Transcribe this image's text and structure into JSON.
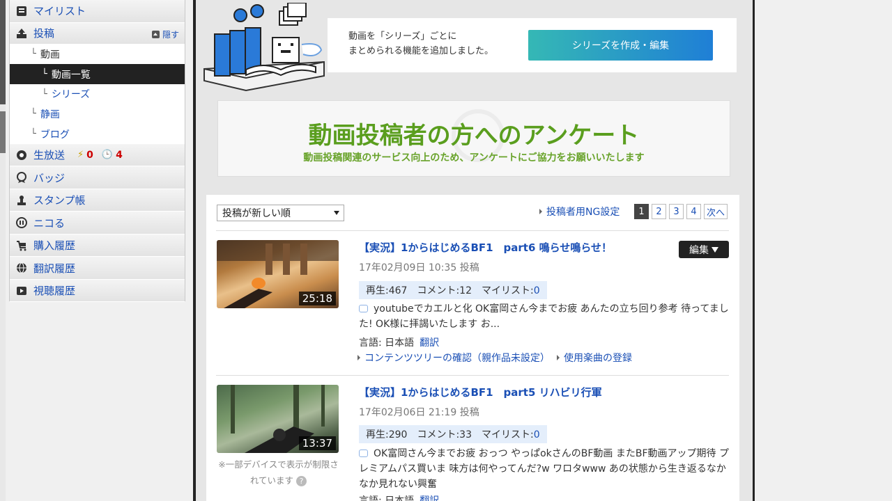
{
  "sidebar": {
    "mylist": "マイリスト",
    "posts": "投稿",
    "hide": "隠す",
    "video": "動画",
    "video_list": "動画一覧",
    "series": "シリーズ",
    "still": "静画",
    "blog": "ブログ",
    "live": "生放送",
    "live_count_a": "0",
    "live_count_b": "4",
    "badge": "バッジ",
    "stamp": "スタンプ帳",
    "nicoru": "ニコる",
    "purchase": "購入履歴",
    "translate": "翻訳履歴",
    "watch_history": "視聴履歴"
  },
  "banner": {
    "line1": "動画を「シリーズ」ごとに",
    "line2": "まとめられる機能を追加しました。",
    "button": "シリーズを作成・編集"
  },
  "survey": {
    "title": "動画投稿者の方へのアンケート",
    "subtitle": "動画投稿関連のサービス向上のため、アンケートにご協力をお願いいたします"
  },
  "toolbar": {
    "sort": "投稿が新しい順",
    "ng_link": "投稿者用NG設定",
    "pages": [
      "1",
      "2",
      "3",
      "4"
    ],
    "next": "次へ"
  },
  "videos": [
    {
      "title": "【実況】1からはじめるBF1　part6 鳴らせ鳴らせ！",
      "date": "17年02月09日 10:35 投稿",
      "duration": "25:18",
      "views": "再生:467",
      "comments": "コメント:12",
      "mylist_label": "マイリスト:",
      "mylist_value": "0",
      "comment_text": "youtubeでカエルと化 OK富岡さん今までお疲 あんたの立ち回り参考 待ってました! OK様に拝謁いたします お...",
      "lang_label": "言語: 日本語",
      "translate": "翻訳",
      "tree_link": "コンテンツツリーの確認（親作品未設定）",
      "music_link": "使用楽曲の登録",
      "edit": "編集"
    },
    {
      "title": "【実況】1からはじめるBF1　part5 リハビリ行軍",
      "date": "17年02月06日 21:19 投稿",
      "duration": "13:37",
      "views": "再生:290",
      "comments": "コメント:33",
      "mylist_label": "マイリスト:",
      "mylist_value": "0",
      "comment_text": "OK富岡さん今までお疲 おっつ やっぱokさんのBF動画 またBF動画アップ期待 プレミアムパス買いま 味方は何やってんだ?w ワロタwww あの状態から生き返るなかなか見れない興奮",
      "lang_label": "言語: 日本語",
      "translate": "翻訳",
      "restriction": "※一部デバイスで表示が制限されています"
    }
  ]
}
